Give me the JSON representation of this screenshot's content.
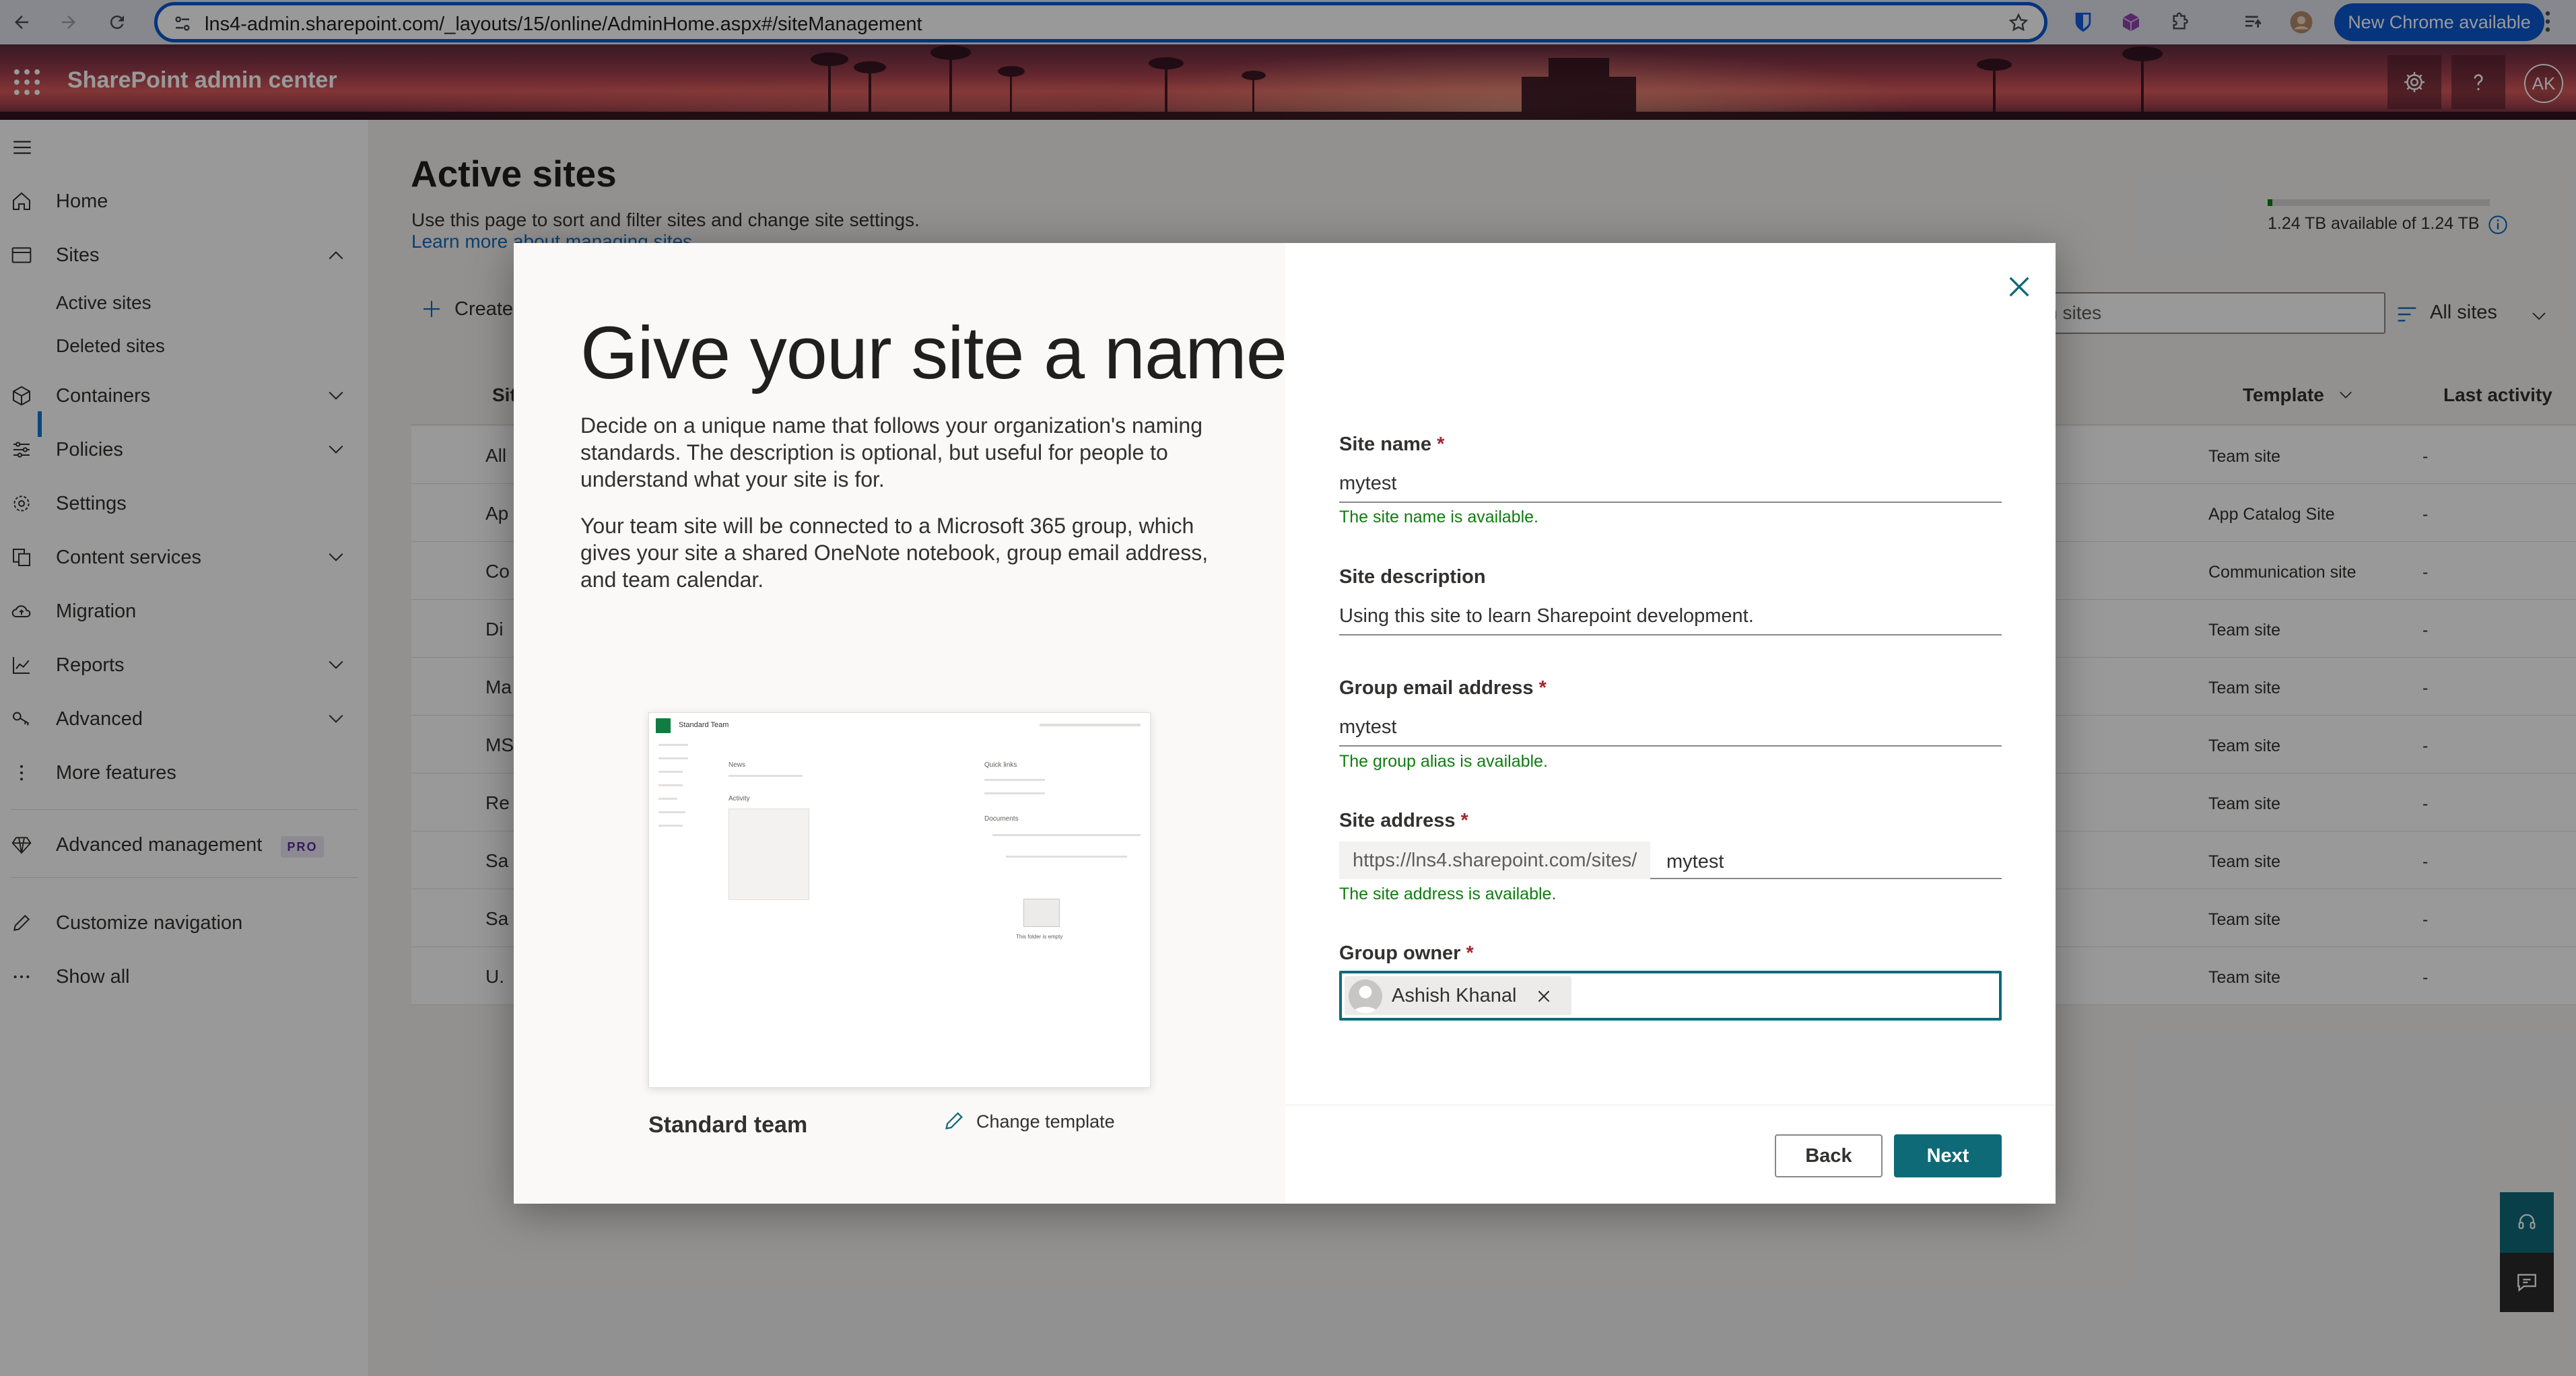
{
  "browser": {
    "url": "lns4-admin.sharepoint.com/_layouts/15/online/AdminHome.aspx#/siteManagement",
    "new_chrome_label": "New Chrome available"
  },
  "header": {
    "app_name": "SharePoint admin center",
    "avatar_initials": "AK"
  },
  "nav": {
    "home": "Home",
    "sites": "Sites",
    "active_sites": "Active sites",
    "deleted_sites": "Deleted sites",
    "containers": "Containers",
    "policies": "Policies",
    "settings": "Settings",
    "content_services": "Content services",
    "migration": "Migration",
    "reports": "Reports",
    "advanced": "Advanced",
    "more_features": "More features",
    "advanced_management": "Advanced management",
    "pro_badge": "PRO",
    "customize_navigation": "Customize navigation",
    "show_all": "Show all"
  },
  "page": {
    "title": "Active sites",
    "description": "Use this page to sort and filter sites and change site settings.",
    "learn_more": "Learn more about managing sites",
    "storage_text": "1.24 TB available of 1.24 TB",
    "storage_used_fraction": 0.02,
    "create_label": "Create",
    "search_placeholder": "Search sites",
    "view_label": "All sites",
    "columns": {
      "site_name": "Site name",
      "template": "Template",
      "last_activity": "Last activity"
    },
    "rows": [
      {
        "name": "All",
        "template": "Team site",
        "activity": "-"
      },
      {
        "name": "Ap",
        "template": "App Catalog Site",
        "activity": "-"
      },
      {
        "name": "Co",
        "template": "Communication site",
        "activity": "-"
      },
      {
        "name": "Di",
        "template": "Team site",
        "activity": "-"
      },
      {
        "name": "Ma",
        "template": "Team site",
        "activity": "-"
      },
      {
        "name": "MS",
        "template": "Team site",
        "activity": "-"
      },
      {
        "name": "Re",
        "template": "Team site",
        "activity": "-"
      },
      {
        "name": "Sa",
        "template": "Team site",
        "activity": "-"
      },
      {
        "name": "Sa",
        "template": "Team site",
        "activity": "-"
      },
      {
        "name": "U.",
        "template": "Team site",
        "activity": "-"
      }
    ]
  },
  "dialog": {
    "title": "Give your site a name",
    "para1": "Decide on a unique name that follows your organization's naming standards. The description is optional, but useful for people to understand what your site is for.",
    "para2": "Your team site will be connected to a Microsoft 365 group, which gives your site a shared OneNote notebook, group email address, and team calendar.",
    "template_name": "Standard team",
    "change_template": "Change template",
    "preview": {
      "site_title": "Standard Team",
      "news": "News",
      "activity": "Activity",
      "quick_links": "Quick links",
      "documents": "Documents",
      "empty": "This folder is empty"
    },
    "fields": {
      "site_name_label": "Site name",
      "site_name_value": "mytest",
      "site_name_status": "The site name is available.",
      "description_label": "Site description",
      "description_value": "Using this site to learn Sharepoint development.",
      "email_label": "Group email address",
      "email_value": "mytest",
      "email_status": "The group alias is available.",
      "address_label": "Site address",
      "address_prefix": "https://lns4.sharepoint.com/sites/",
      "address_value": "mytest",
      "address_status": "The site address is available.",
      "owner_label": "Group owner",
      "owner_value": "Ashish Khanal"
    },
    "back_label": "Back",
    "next_label": "Next"
  }
}
